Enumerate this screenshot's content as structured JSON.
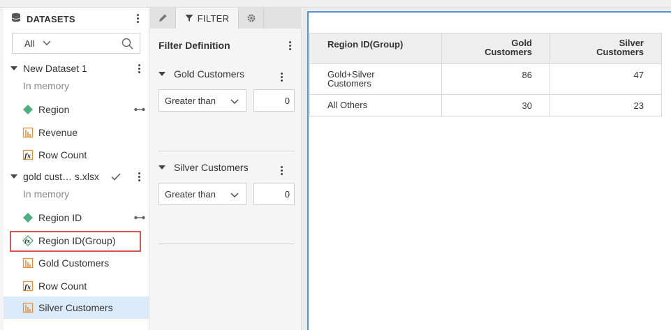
{
  "datasets_panel": {
    "title": "DATASETS",
    "filter_select": {
      "value": "All"
    },
    "datasets": [
      {
        "name": "New Dataset 1",
        "status": "In memory",
        "fields": [
          {
            "label": "Region",
            "icon": "dimension-icon"
          },
          {
            "label": "Revenue",
            "icon": "measure-icon"
          },
          {
            "label": "Row Count",
            "icon": "formula-icon"
          }
        ]
      },
      {
        "name": "gold cust…  s.xlsx",
        "status": "In memory",
        "fields": [
          {
            "label": "Region ID",
            "icon": "dimension-icon"
          },
          {
            "label": "Region ID(Group)",
            "icon": "calculated-dimension-icon"
          },
          {
            "label": "Gold Customers",
            "icon": "measure-icon"
          },
          {
            "label": "Row Count",
            "icon": "formula-icon"
          },
          {
            "label": "Silver Customers",
            "icon": "measure-icon"
          }
        ]
      }
    ]
  },
  "filter_panel": {
    "tabs": [
      {
        "label": "",
        "icon": "pencil-icon"
      },
      {
        "label": "FILTER",
        "icon": "filter-icon"
      },
      {
        "label": "",
        "icon": "gear-icon"
      }
    ],
    "title": "Filter Definition",
    "filters": [
      {
        "field": "Gold Customers",
        "operator": "Greater than",
        "value": "0"
      },
      {
        "field": "Silver Customers",
        "operator": "Greater than",
        "value": "0"
      }
    ]
  },
  "table": {
    "headers": [
      "Region ID(Group)",
      "Gold\nCustomers",
      "Silver\nCustomers"
    ],
    "rows": [
      [
        "Gold+Silver\nCustomers",
        "86",
        "47"
      ],
      [
        "All Others",
        "30",
        "23"
      ]
    ]
  },
  "colors": {
    "selection": "#dcebfa",
    "highlight_border": "#d9534f",
    "active_border": "#5b8fd6",
    "dimension_icon": "#4caf7d",
    "measure_icon": "#e8913a"
  }
}
